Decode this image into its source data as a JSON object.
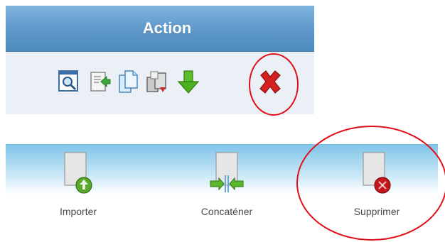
{
  "action_panel": {
    "title": "Action",
    "icons": [
      {
        "name": "preview-icon"
      },
      {
        "name": "export-icon"
      },
      {
        "name": "copy-icon"
      },
      {
        "name": "duplicate-icon"
      },
      {
        "name": "download-icon"
      },
      {
        "name": "delete-icon"
      }
    ]
  },
  "toolbar": {
    "items": [
      {
        "label": "Importer",
        "icon": "import-icon"
      },
      {
        "label": "Concaténer",
        "icon": "concatenate-icon"
      },
      {
        "label": "Supprimer",
        "icon": "delete-icon"
      }
    ]
  },
  "colors": {
    "header_blue": "#5d97c9",
    "icon_bar_bg": "#eaf0f5",
    "highlight_circle": "#e0101a",
    "delete_red": "#d42020",
    "download_green": "#4caf1f"
  }
}
